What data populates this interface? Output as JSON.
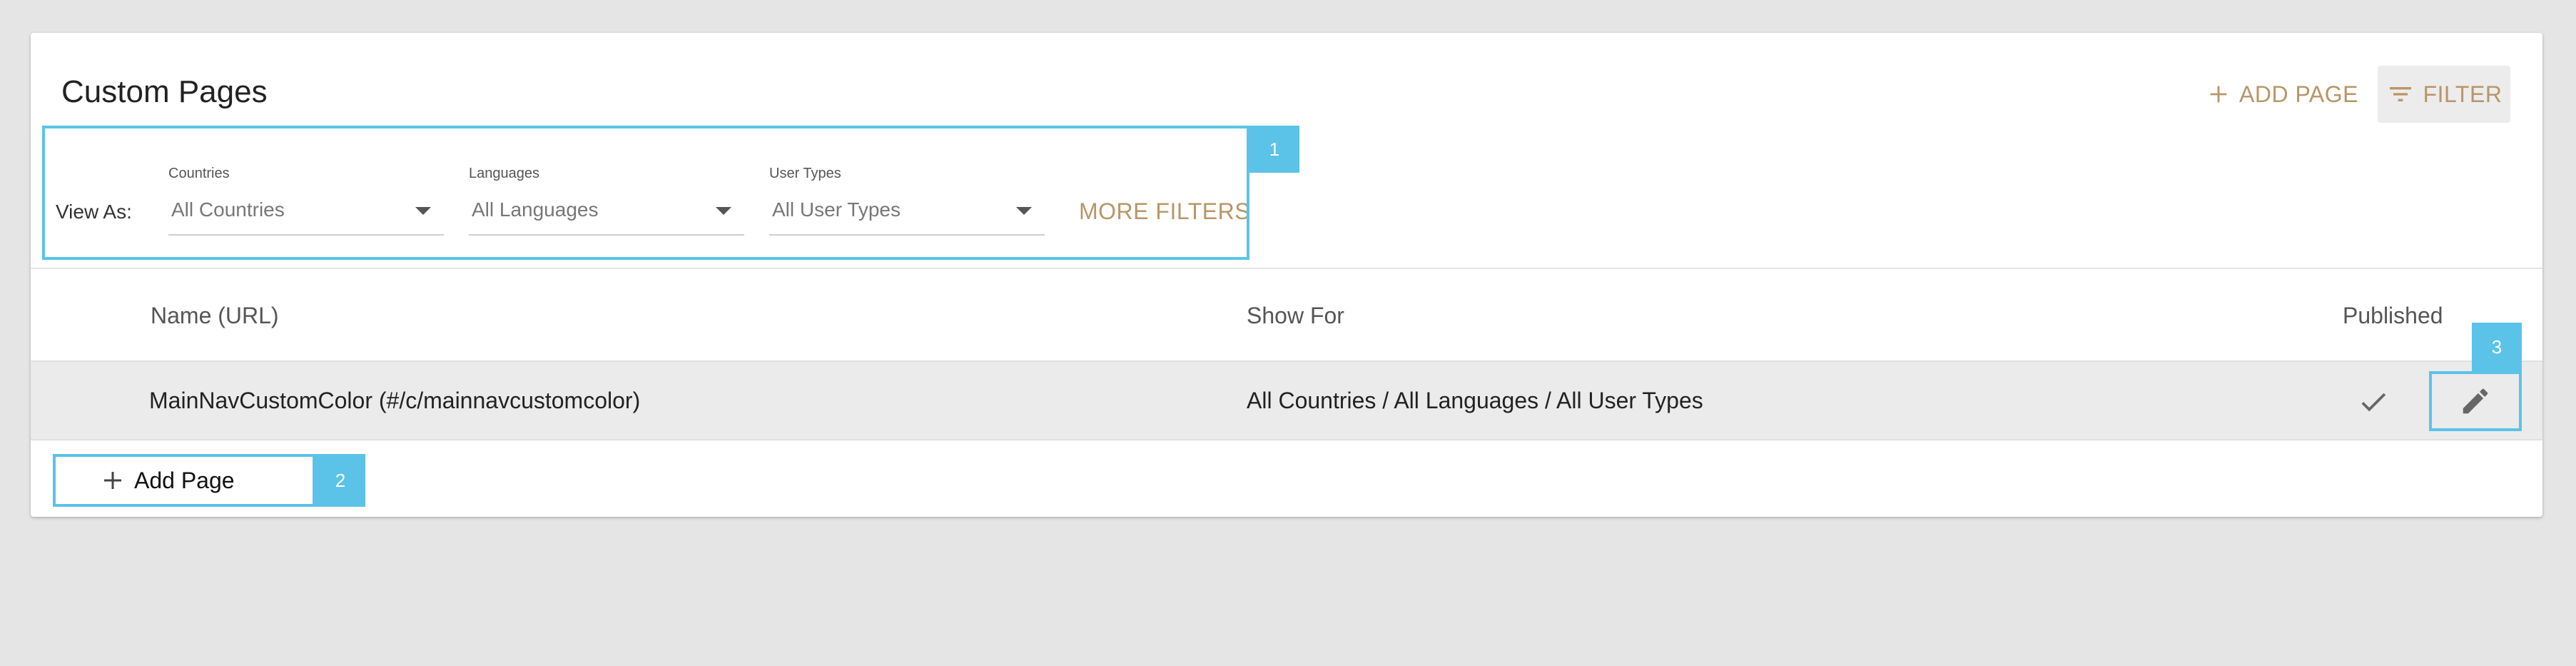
{
  "header": {
    "title": "Custom Pages",
    "add_page_label": "ADD PAGE",
    "filter_label": "FILTER"
  },
  "filters": {
    "view_as_label": "View As:",
    "countries": {
      "label": "Countries",
      "value": "All Countries"
    },
    "languages": {
      "label": "Languages",
      "value": "All Languages"
    },
    "user_types": {
      "label": "User Types",
      "value": "All User Types"
    },
    "more_filters_label": "MORE FILTERS"
  },
  "table": {
    "columns": [
      "Name (URL)",
      "Show For",
      "Published"
    ],
    "rows": [
      {
        "name": "MainNavCustomColor (#/c/mainnavcustomcolor)",
        "show_for": "All Countries / All Languages / All User Types",
        "published": true
      }
    ]
  },
  "footer": {
    "add_page_label": "Add Page"
  },
  "annotations": [
    "1",
    "2",
    "3"
  ],
  "colors": {
    "accent": "#b99567",
    "annotation": "#5bc3e8",
    "background": "#e5e5e5"
  },
  "icons": {
    "add": "plus-icon",
    "filter": "filter-list-icon",
    "check": "check-icon",
    "edit": "pencil-icon",
    "dropdown": "caret-down-icon"
  }
}
